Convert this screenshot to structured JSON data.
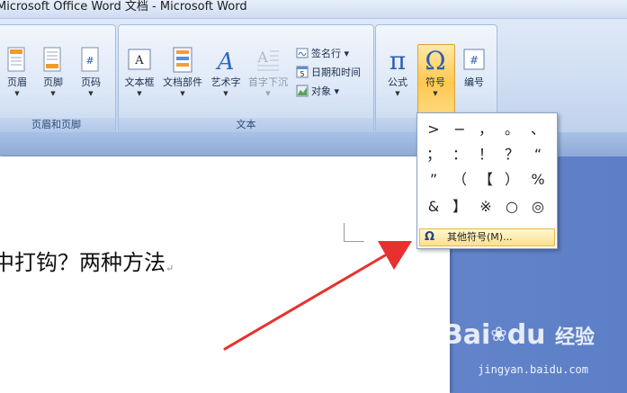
{
  "window": {
    "title": "Microsoft Office Word 文档 - Microsoft Word"
  },
  "ribbon": {
    "header_footer_group": {
      "label": "页眉和页脚",
      "buttons": [
        {
          "label": "页眉"
        },
        {
          "label": "页脚"
        },
        {
          "label": "页码"
        }
      ]
    },
    "text_group": {
      "label": "文本",
      "buttons": [
        {
          "label": "文本框"
        },
        {
          "label": "文档部件"
        },
        {
          "label": "艺术字"
        },
        {
          "label": "首字下沉"
        }
      ],
      "small_buttons": [
        {
          "label": "签名行 ▾"
        },
        {
          "label": "日期和时间"
        },
        {
          "label": "对象 ▾"
        }
      ]
    },
    "symbols_group": {
      "buttons": [
        {
          "label": "公式"
        },
        {
          "label": "符号"
        },
        {
          "label": "编号"
        }
      ]
    }
  },
  "symbol_dropdown": {
    "symbols": [
      ">",
      "−",
      "，",
      "。",
      "、",
      "；",
      "：",
      "！",
      "？",
      "“",
      "”",
      "（",
      "【",
      "）",
      "%",
      "&",
      "】",
      "※",
      "○",
      "◎"
    ],
    "more_label": "其他符号(M)..."
  },
  "document": {
    "text": "中打钩？两种方法",
    "paragraph_mark": "↵"
  },
  "watermark": {
    "brand": "Bai",
    "brand_suffix": "du",
    "cn": "经验",
    "url": "jingyan.baidu.com"
  }
}
